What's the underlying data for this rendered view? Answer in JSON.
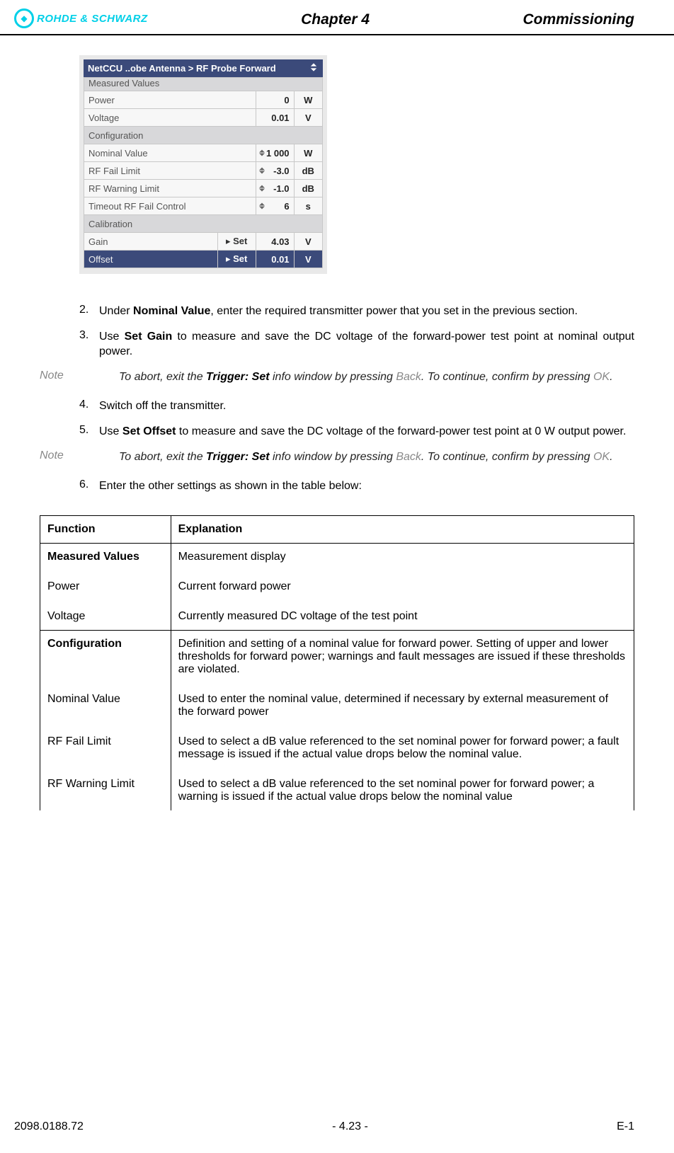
{
  "header": {
    "logo_text": "ROHDE & SCHWARZ",
    "chapter": "Chapter 4",
    "section": "Commissioning"
  },
  "device": {
    "title": "NetCCU ..obe Antenna > RF Probe Forward",
    "sections": {
      "measured": "Measured Values",
      "config": "Configuration",
      "calib": "Calibration"
    },
    "rows": {
      "power": {
        "label": "Power",
        "value": "0",
        "unit": "W"
      },
      "voltage": {
        "label": "Voltage",
        "value": "0.01",
        "unit": "V"
      },
      "nominal": {
        "label": "Nominal Value",
        "value": "1 000",
        "unit": "W"
      },
      "fail": {
        "label": "RF Fail Limit",
        "value": "-3.0",
        "unit": "dB"
      },
      "warn": {
        "label": "RF Warning Limit",
        "value": "-1.0",
        "unit": "dB"
      },
      "timeout": {
        "label": "Timeout RF Fail Control",
        "value": "6",
        "unit": "s"
      },
      "gain": {
        "label": "Gain",
        "btn": "Set",
        "value": "4.03",
        "unit": "V"
      },
      "offset": {
        "label": "Offset",
        "btn": "Set",
        "value": "0.01",
        "unit": "V"
      }
    }
  },
  "steps": {
    "s2": {
      "num": "2.",
      "pre": "Under ",
      "bold": "Nominal Value",
      "post": ", enter the required transmitter power that you set in the previous section."
    },
    "s3": {
      "num": "3.",
      "pre": "Use ",
      "bold": "Set Gain",
      "post": " to measure and save the DC voltage of the forward-power test point at nominal output power."
    },
    "s4": {
      "num": "4.",
      "text": "Switch off the transmitter."
    },
    "s5": {
      "num": "5.",
      "pre": "Use ",
      "bold": "Set Offset",
      "post": " to measure and save the DC voltage of the forward-power test point at 0 W output power."
    },
    "s6": {
      "num": "6.",
      "text": "Enter the other settings as shown in the table below:"
    }
  },
  "note": {
    "label": "Note",
    "pre": "To abort, exit the ",
    "trigger": "Trigger: Set",
    "mid1": " info window by pressing ",
    "back": "Back",
    "mid2": ". To continue, confirm by pressing ",
    "ok": "OK",
    "end": "."
  },
  "table": {
    "head": {
      "func": "Function",
      "expl": "Explanation"
    },
    "rows": {
      "mv": {
        "func": "Measured Values",
        "bold": true,
        "expl": "Measurement display"
      },
      "power": {
        "func": "Power",
        "expl": "Current forward power"
      },
      "volt": {
        "func": "Voltage",
        "expl": "Currently measured DC voltage of the test point"
      },
      "cfg": {
        "func": "Configuration",
        "bold": true,
        "expl": "Definition and setting of a nominal value for forward power. Setting of upper and lower thresholds for forward power; warnings and fault messages are issued if these thresholds are violated."
      },
      "nom": {
        "func": "Nominal Value",
        "expl": "Used to enter the nominal value, determined if necessary by external measurement of the forward power"
      },
      "fail": {
        "func": "RF Fail Limit",
        "expl": "Used to select a dB value referenced to the set nominal power for forward power; a fault message is issued if the actual value drops below the nominal value."
      },
      "warn": {
        "func": "RF Warning Limit",
        "expl": "Used to select a dB value referenced to the set nominal power for forward power; a warning is issued if the actual value drops below the nominal value"
      }
    }
  },
  "footer": {
    "left": "2098.0188.72",
    "center": "- 4.23 -",
    "right": "E-1"
  }
}
